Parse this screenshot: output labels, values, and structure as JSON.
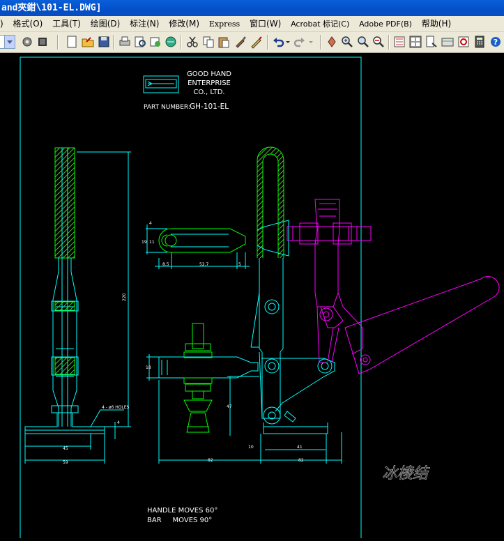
{
  "window": {
    "title": "and夾鉗\\101-EL.DWG]"
  },
  "menu": {
    "items": [
      "格式(O)",
      "工具(T)",
      "绘图(D)",
      "标注(N)",
      "修改(M)",
      "Express",
      "窗口(W)",
      "Acrobat 标记(C)",
      "Adobe PDF(B)",
      "帮助(H)"
    ],
    "leading_fragment": ")"
  },
  "drawing": {
    "company": [
      "GOOD HAND",
      "ENTERPRISE",
      "CO., LTD."
    ],
    "part_number_label": "PART NUMBER:",
    "part_number": "GH-101-EL",
    "notes": [
      "HANDLE MOVES 60°",
      "BAR     MOVES 90°"
    ],
    "dim_left_overall": "220",
    "dim_holes": "4 - ø6 HOLES",
    "dim_base_inner": "45",
    "dim_base_outer": "59",
    "dim_base_thk": "4",
    "dim_bar_height": "19",
    "dim_bar_gap": "11",
    "dim_bar_top": "4",
    "dim_bar_left": "8.5",
    "dim_bar_len": "52.7",
    "dim_bar_right": "5",
    "dim_arm_height": "18",
    "dim_pivot_height": "47",
    "dim_bottom_10": "10",
    "dim_bottom_41": "41",
    "dim_bottom_left": "82",
    "dim_bottom_right": "82"
  },
  "colors": {
    "green": "#00ff00",
    "cyan": "#00ffff",
    "magenta": "#ff00ff",
    "white": "#ffffff",
    "hatch": "#4fbf2f"
  },
  "watermark": "冰棱结"
}
